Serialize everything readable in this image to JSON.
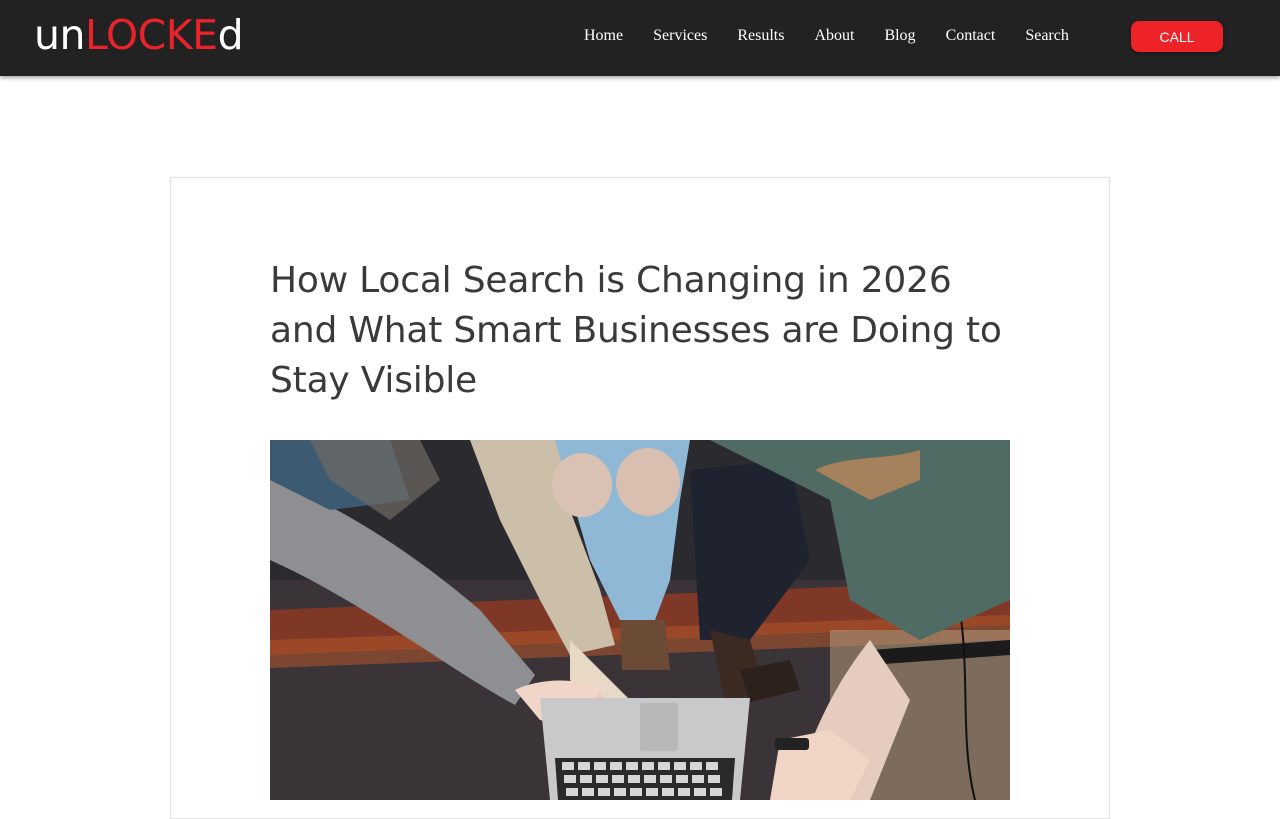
{
  "header": {
    "logo": {
      "part1": "un",
      "part2": "LOCKE",
      "part3": "d"
    },
    "nav": [
      {
        "label": "Home"
      },
      {
        "label": "Services"
      },
      {
        "label": "Results"
      },
      {
        "label": "About"
      },
      {
        "label": "Blog"
      },
      {
        "label": "Contact"
      },
      {
        "label": "Search"
      }
    ],
    "call_label": "CALL"
  },
  "post": {
    "title": "How Local Search is Changing in 2026 and What Smart Businesses are Doing to Stay Visible"
  },
  "colors": {
    "header_bg": "#222222",
    "brand_red": "#ee2328",
    "title_text": "#3a3a3a"
  },
  "icons": {
    "logo": "unlocked-wordmark"
  }
}
